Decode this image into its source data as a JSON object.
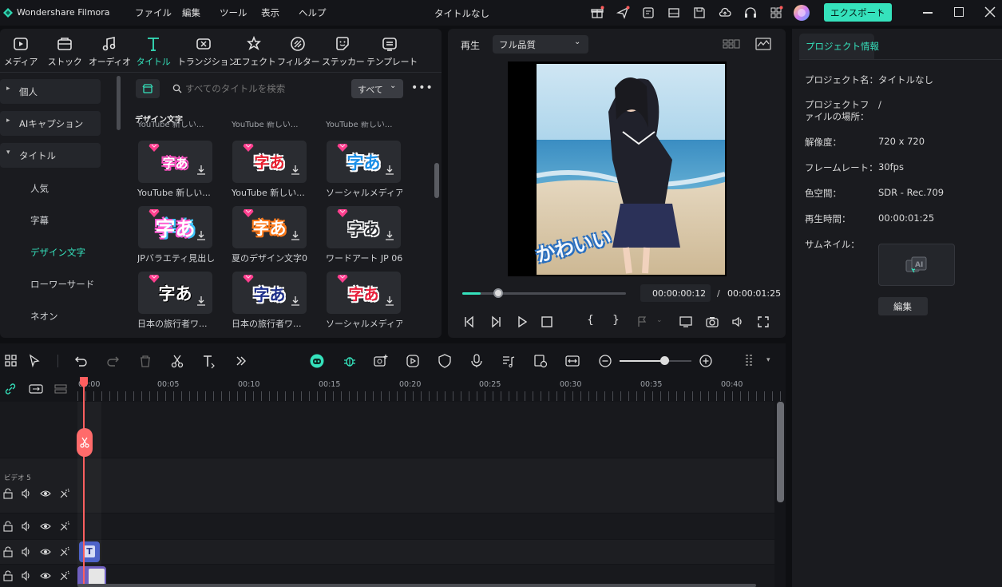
{
  "app": {
    "name": "Wondershare Filmora",
    "window_title": "タイトルなし"
  },
  "menu": [
    "ファイル",
    "編集",
    "ツール",
    "表示",
    "ヘルプ"
  ],
  "export_label": "エクスポート",
  "tabs": [
    {
      "label": "メディア",
      "icon": "media-icon"
    },
    {
      "label": "ストック",
      "icon": "stock-icon"
    },
    {
      "label": "オーディオ",
      "icon": "audio-icon"
    },
    {
      "label": "タイトル",
      "icon": "title-icon",
      "active": true
    },
    {
      "label": "トランジション",
      "icon": "transition-icon"
    },
    {
      "label": "エフェクト",
      "icon": "effect-icon"
    },
    {
      "label": "フィルター",
      "icon": "filter-icon"
    },
    {
      "label": "ステッカー",
      "icon": "sticker-icon"
    },
    {
      "label": "テンプレート",
      "icon": "template-icon"
    }
  ],
  "sidebar": {
    "items": [
      "個人",
      "AIキャプション",
      "タイトル"
    ],
    "sub": [
      "人気",
      "字幕",
      "デザイン文字",
      "ローワーサード",
      "ネオン"
    ]
  },
  "search": {
    "placeholder": "すべてのタイトルを検索",
    "filter": "すべて"
  },
  "section_title": "デザイン文字",
  "cut_labels": [
    "YouTube 新しい...",
    "YouTube 新しい...",
    "YouTube 新しい..."
  ],
  "cards": [
    {
      "text": "字あ",
      "label": "YouTube 新しい..."
    },
    {
      "text": "字あ",
      "label": "YouTube 新しい..."
    },
    {
      "text": "字あ",
      "label": "ソーシャルメディア..."
    },
    {
      "text": "字あ",
      "label": "JPバラエティ見出し..."
    },
    {
      "text": "字あ",
      "label": "夏のデザイン文字01"
    },
    {
      "text": "字あ",
      "label": "ワードアート JP 06"
    },
    {
      "text": "字あ",
      "label": "日本の旅行者ワ..."
    },
    {
      "text": "字あ",
      "label": "日本の旅行者ワ..."
    },
    {
      "text": "字あ",
      "label": "ソーシャルメディア..."
    }
  ],
  "preview": {
    "play_label": "再生",
    "quality": "フル品質",
    "overlay_text": "かわいい",
    "current_time": "00:00:00:12",
    "separator": "/",
    "total_time": "00:00:01:25",
    "progress": 0.11
  },
  "project_info": {
    "tab": "プロジェクト情報",
    "rows": [
      {
        "key": "プロジェクト名：",
        "value": "タイトルなし"
      },
      {
        "key": "プロジェクトファイルの場所：",
        "value": "/"
      },
      {
        "key": "解像度：",
        "value": "720 x 720"
      },
      {
        "key": "フレームレート：",
        "value": "30fps"
      },
      {
        "key": "色空間：",
        "value": "SDR - Rec.709"
      },
      {
        "key": "再生時間：",
        "value": "00:00:01:25"
      },
      {
        "key": "サムネイル：",
        "value": ""
      }
    ],
    "edit_label": "編集"
  },
  "timeline": {
    "ruler": [
      "00:00",
      "00:05",
      "00:10",
      "00:15",
      "00:20",
      "00:25",
      "00:30",
      "00:35",
      "00:40"
    ],
    "track_label": "ビデオ 5",
    "zoom_level": 0.62
  },
  "colors": {
    "accent": "#35e2bc",
    "playhead": "#ff5f5f",
    "title_clip": "#4e63c8"
  }
}
